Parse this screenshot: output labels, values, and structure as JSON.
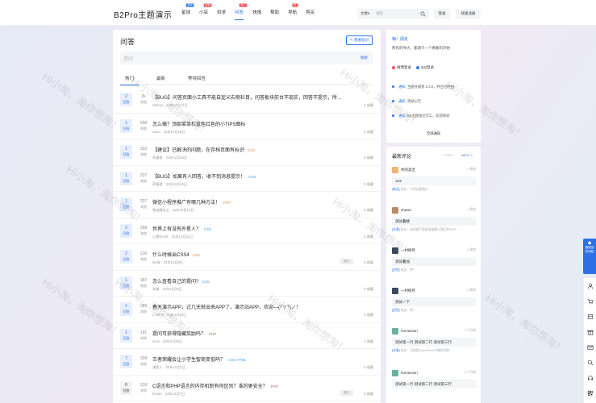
{
  "logo": "B2Pro主题演示",
  "nav": [
    {
      "label": "星球",
      "badge": "发现",
      "badge_color": "#3b7cf0"
    },
    {
      "label": "小店",
      "badge": "好物",
      "badge_color": "#f0555c"
    },
    {
      "label": "供求",
      "badge": "",
      "badge_color": ""
    },
    {
      "label": "问答",
      "badge": "热门",
      "badge_color": "#f0555c",
      "active": true
    },
    {
      "label": "快报",
      "badge": "",
      "badge_color": ""
    },
    {
      "label": "帮助",
      "badge": "",
      "badge_color": ""
    },
    {
      "label": "导航",
      "badge": "热",
      "badge_color": "#f0555c"
    },
    {
      "label": "购买",
      "badge": "",
      "badge_color": ""
    }
  ],
  "search": {
    "type": "文章▾",
    "placeholder": "搜索"
  },
  "header_buttons": {
    "login": "登录",
    "register": "快速注册"
  },
  "main": {
    "title": "问答",
    "ask_button": "我要提问",
    "ask_placeholder": "提问",
    "ask_search": "搜索",
    "tabs": [
      "热门",
      "最新",
      "等待回答"
    ],
    "questions": [
      {
        "answers": "2",
        "answers_label": "回答",
        "views": "2k",
        "views_label": "浏览",
        "title": "【BUG】问答页面小工具不能自定义右侧栏目，问答板块前台不现实，回答不提示，所…",
        "tag": "",
        "tag_color": "",
        "author": "wzthou",
        "date": "22年12月17日",
        "fav": "4 收藏",
        "image": ""
      },
      {
        "answers": "1",
        "answers_label": "回答",
        "views": "558",
        "views_label": "浏览",
        "title": "怎么搞？顶部菜单栏蓝色红色的小TIPS图标",
        "tag": "",
        "tag_color": "",
        "author": "Sean",
        "date": "22年12月16日",
        "fav": "0 收藏",
        "image": ""
      },
      {
        "answers": "1",
        "answers_label": "回答",
        "views": "333",
        "views_label": "浏览",
        "title": "【建议】已解决的问题，在存档页面有标识",
        "tag": "CSS",
        "tag_color": "#f08a3c",
        "author": "荷塘君",
        "date": "22年12月15日",
        "fav": "0 收藏",
        "image": ""
      },
      {
        "answers": "1",
        "answers_label": "回答",
        "views": "237",
        "views_label": "浏览",
        "title": "【BUG】如果有人回答，收不到消息提示！",
        "tag": "CSS",
        "tag_color": "#3b9cf0",
        "author": "荷塘君",
        "date": "22年12月15日",
        "fav": "0 收藏",
        "image": ""
      },
      {
        "answers": "1",
        "answers_label": "回答",
        "views": "207",
        "views_label": "浏览",
        "title": "微信小程序推广有哪几种方法！",
        "tag": "PHP",
        "tag_color": "#f08a3c",
        "author": "黎由藤化工",
        "date": "22年12月14日",
        "fav": "0 收藏",
        "image": ""
      },
      {
        "answers": "2",
        "answers_label": "回答",
        "views": "258",
        "views_label": "浏览",
        "title": "世界上有没有外星人？",
        "tag": "CSS",
        "tag_color": "#3b9cf0",
        "author": "心愿DeGE",
        "date": "22年12月11日",
        "fav": "0 收藏",
        "image": ""
      },
      {
        "answers": "2",
        "answers_label": "回答",
        "views": "216",
        "views_label": "浏览",
        "title": "什么时候出CSS4",
        "tag": "CSS",
        "tag_color": "#f08a3c",
        "author": "Molly",
        "date": "22年12月9日",
        "fav": "0 收藏",
        "image": "图片"
      },
      {
        "answers": "1",
        "answers_label": "回答",
        "views": "187",
        "views_label": "浏览",
        "title": "怎么查看自己的提问?",
        "tag": "CSS",
        "tag_color": "#3b9cf0",
        "author": "有趣",
        "date": "22年12月9日",
        "fav": "0 收藏",
        "image": ""
      },
      {
        "answers": "1",
        "answers_label": "回答",
        "views": "289",
        "views_label": "浏览",
        "title": "春天演示APP，过几天就出来APP了，演示站APP，欢迎—(╯▽╰)ノ！",
        "tag": "",
        "tag_color": "",
        "author": "L70676",
        "date": "22年12月9日",
        "fav": "0 收藏",
        "image": ""
      },
      {
        "answers": "1",
        "answers_label": "回答",
        "views": "191",
        "views_label": "浏览",
        "title": "提问可获得隐藏奖励吗？",
        "tag": "PHP",
        "tag_color": "#f0555c",
        "author": "innei",
        "date": "22年12月8日",
        "fav": "1 收藏",
        "image": ""
      },
      {
        "answers": "7",
        "answers_label": "回答",
        "views": "309",
        "views_label": "浏览",
        "title": "王者荣耀会让小学生智商变低吗？",
        "tag": "CSS  HTML",
        "tag_color": "#3b9cf0",
        "author": "漫索人",
        "date": "22年12月7日",
        "fav": "0 收藏",
        "image": ""
      },
      {
        "answers": "0",
        "answers_label": "回答",
        "views": "219",
        "views_label": "浏览",
        "title": "C语言和PHP语言的内存机制有何区别？谁的更安全？",
        "tag": "PHP",
        "tag_color": "#f0555c",
        "author": "hunter",
        "date": "22年12月7日",
        "fav": "0 收藏",
        "image": "图片"
      }
    ]
  },
  "side_user": {
    "hi": "嗨！朋友",
    "sub": "所有的伟大，都源于一个勇敢的开始",
    "logins": [
      {
        "label": "微博登录",
        "color": "#f0555c"
      },
      {
        "label": "QQ登录",
        "color": "#3b7cf0"
      }
    ],
    "notices": [
      {
        "label": "通知:",
        "text": "主题升级到 2.3.0，并且已经由···"
      },
      {
        "label": "通知:",
        "text": "测试公告"
      },
      {
        "label": "通知:",
        "text": "B2主题接近完工，欢迎体验"
      }
    ],
    "all": "全部通知"
  },
  "comments": {
    "title": "最新评论",
    "prev": "< PREV",
    "next": "NEXT >",
    "items": [
      {
        "user": "你的美宝",
        "time": "1 周前",
        "body": "123",
        "src_label": "[商品]",
        "src": "来自：卡密自营演示",
        "avatar": "#f0b37a"
      },
      {
        "user": "shawn",
        "time": "1 周前",
        "body": "测试叠楼",
        "src_label": "[文章]",
        "src": "来自：若你取气急躁准确建立图片和APP···",
        "avatar": "#b98a6a"
      },
      {
        "user": "一村柳月",
        "time": "2 周前",
        "body": "测试叠加",
        "src_label": "[回答]",
        "src": "来自：呼！",
        "avatar": "#3a4a5a"
      },
      {
        "user": "一村柳月",
        "time": "2 周前",
        "body": "测试一下",
        "src_label": "[回答]",
        "src": "来自：呼！",
        "avatar": "#3a4a5a"
      },
      {
        "user": "hometown",
        "time": "1 个月前",
        "body": "测试第一行 测试第二行 测试第三行",
        "src_label": "[文章]",
        "src": "来自：可能是WordPress中最好的那···",
        "avatar": "#6bb0a3"
      },
      {
        "user": "hometown",
        "time": "1 个月前",
        "body": "测试第一行 测试第二行 测试第三行",
        "src_label": "",
        "src": "",
        "avatar": "#6bb0a3"
      }
    ]
  },
  "float_button": "展现会员特权",
  "watermark": "Hi小淘，淘你想淘！",
  "rail_icons": [
    "user-icon",
    "cart-icon",
    "card-icon",
    "gift-icon",
    "mail-icon",
    "search-icon",
    "headset-icon",
    "qrcode-icon"
  ]
}
